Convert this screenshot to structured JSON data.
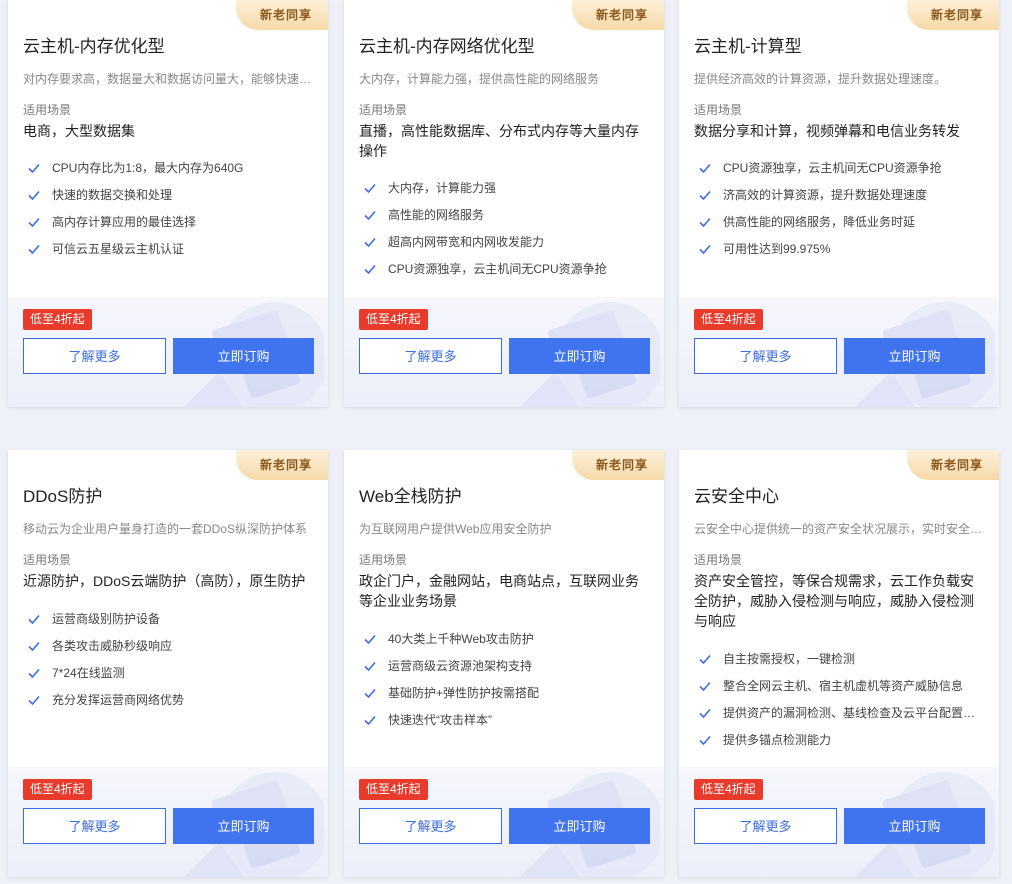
{
  "badge": "新老同享",
  "scene_label": "适用场景",
  "promo": "低至4折起",
  "btn_more": "了解更多",
  "btn_buy": "立即订购",
  "colors": {
    "primary": "#3f74ee",
    "promo": "#e83b2c",
    "badge_text": "#8b5a1f",
    "check": "#3a6de0"
  },
  "cards": [
    {
      "title": "云主机-内存优化型",
      "desc": "对内存要求高，数据量大和数据访问量大，能够快速交换和处理大量数据的业务场景",
      "scene": "电商，大型数据集",
      "features": [
        "CPU内存比为1:8，最大内存为640G",
        "快速的数据交换和处理",
        "高内存计算应用的最佳选择",
        "可信云五星级云主机认证"
      ]
    },
    {
      "title": "云主机-内存网络优化型",
      "desc": "大内存，计算能力强，提供高性能的网络服务",
      "scene": "直播，高性能数据库、分布式内存等大量内存操作",
      "features": [
        "大内存，计算能力强",
        "高性能的网络服务",
        "超高内网带宽和内网收发能力",
        "CPU资源独享，云主机间无CPU资源争抢"
      ]
    },
    {
      "title": "云主机-计算型",
      "desc": "提供经济高效的计算资源，提升数据处理速度。",
      "scene": "数据分享和计算，视频弹幕和电信业务转发",
      "features": [
        "CPU资源独享，云主机间无CPU资源争抢",
        "济高效的计算资源，提升数据处理速度",
        "供高性能的网络服务，降低业务时延",
        "可用性达到99.975%"
      ]
    },
    {
      "title": "DDoS防护",
      "desc": "移动云为企业用户量身打造的一套DDoS纵深防护体系",
      "scene": "近源防护，DDoS云端防护（高防），原生防护",
      "features": [
        "运营商级别防护设备",
        "各类攻击威胁秒级响应",
        "7*24在线监测",
        "充分发挥运营商网络优势"
      ]
    },
    {
      "title": "Web全栈防护",
      "desc": "为互联网用户提供Web应用安全防护",
      "scene": "政企门户，金融网站，电商站点，互联网业务等企业业务场景",
      "features": [
        "40大类上千种Web攻击防护",
        "运营商级云资源池架构支持",
        "基础防护+弹性防护按需搭配",
        "快速迭代“攻击样本”"
      ]
    },
    {
      "title": "云安全中心",
      "desc": "云安全中心提供统一的资产安全状况展示，实时安全威胁监测与响应",
      "scene": "资产安全管控，等保合规需求，云工作负载安全防护，威胁入侵检测与响应，威胁入侵检测与响应",
      "features": [
        "自主按需授权，一键检测",
        "整合全网云主机、宿主机虚机等资产威胁信息",
        "提供资产的漏洞检测、基线检查及云平台配置检查",
        "提供多锚点检测能力"
      ]
    }
  ]
}
